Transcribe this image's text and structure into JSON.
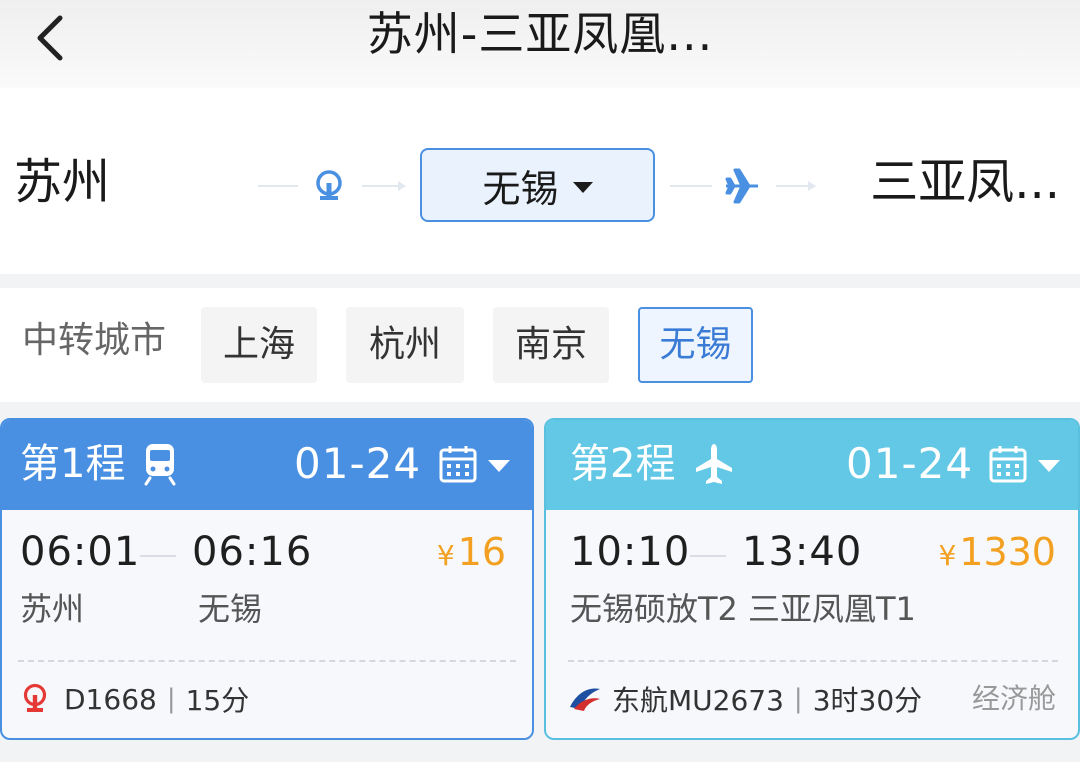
{
  "header": {
    "title": "苏州-三亚凤凰..."
  },
  "route": {
    "origin": "苏州",
    "transfer_city": "无锡",
    "destination": "三亚凤..."
  },
  "transfer": {
    "label": "中转城市",
    "options": [
      "上海",
      "杭州",
      "南京",
      "无锡"
    ],
    "selected": "无锡"
  },
  "legs": [
    {
      "title": "第1程",
      "mode_icon": "train-icon",
      "date": "01-24",
      "depart_time": "06:01",
      "arrive_time": "06:16",
      "currency": "¥",
      "price": "16",
      "from_station": "苏州",
      "to_station": "无锡",
      "carrier_icon": "china-rail-icon",
      "number": "D1668",
      "duration": "15分",
      "cabin": ""
    },
    {
      "title": "第2程",
      "mode_icon": "plane-icon",
      "date": "01-24",
      "depart_time": "10:10",
      "arrive_time": "13:40",
      "currency": "¥",
      "price": "1330",
      "from_station": "无锡硕放T2",
      "to_station": "三亚凤凰T1",
      "carrier_icon": "china-eastern-logo",
      "number": "东航MU2673",
      "duration": "3时30分",
      "cabin": "经济舱"
    }
  ],
  "colors": {
    "accent": "#4a90e2",
    "leg2_header": "#62c8e6",
    "price": "#f3a021"
  }
}
